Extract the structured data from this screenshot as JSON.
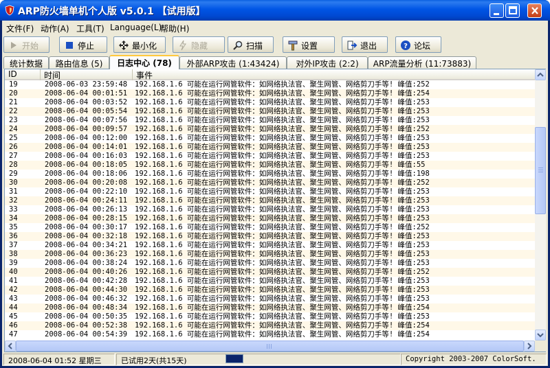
{
  "window": {
    "title": "ARP防火墙单机个人版 v5.0.1 【试用版】",
    "icon": "shield-icon"
  },
  "menu": {
    "items": [
      "文件(F)",
      "动作(A)",
      "工具(T)",
      "Language(L)",
      "帮助(H)"
    ]
  },
  "toolbar": {
    "buttons": [
      {
        "label": "开始",
        "icon": "play-icon",
        "enabled": false
      },
      {
        "label": "停止",
        "icon": "stop-icon",
        "enabled": true
      },
      {
        "label": "最小化",
        "icon": "minimize-arrows-icon",
        "enabled": true
      },
      {
        "label": "隐藏",
        "icon": "hide-icon",
        "enabled": false
      },
      {
        "label": "扫描",
        "icon": "magnifier-icon",
        "enabled": true
      },
      {
        "label": "设置",
        "icon": "settings-icon",
        "enabled": true
      },
      {
        "label": "退出",
        "icon": "exit-icon",
        "enabled": true
      },
      {
        "label": "论坛",
        "icon": "help-icon",
        "enabled": true
      }
    ]
  },
  "tabs": [
    {
      "label": "统计数据",
      "active": false
    },
    {
      "label": "路由信息 (5)",
      "active": false
    },
    {
      "label": "日志中心 (78)",
      "active": true
    },
    {
      "label": "外部ARP攻击 (1:43424)",
      "active": false
    },
    {
      "label": "对外IP攻击 (2:2)",
      "active": false
    },
    {
      "label": "ARP流量分析 (11:73883)",
      "active": false
    }
  ],
  "log": {
    "columns": [
      "ID",
      "时间",
      "事件"
    ],
    "rows": [
      [
        "19",
        "2008-06-03 23:59:48",
        "192.168.1.6 可能在运行网管软件：如网络执法官、聚生网管、网络剪刀手等! 峰值:252"
      ],
      [
        "20",
        "2008-06-04 00:01:51",
        "192.168.1.6 可能在运行网管软件：如网络执法官、聚生网管、网络剪刀手等! 峰值:254"
      ],
      [
        "21",
        "2008-06-04 00:03:52",
        "192.168.1.6 可能在运行网管软件：如网络执法官、聚生网管、网络剪刀手等! 峰值:253"
      ],
      [
        "22",
        "2008-06-04 00:05:54",
        "192.168.1.6 可能在运行网管软件：如网络执法官、聚生网管、网络剪刀手等! 峰值:253"
      ],
      [
        "23",
        "2008-06-04 00:07:56",
        "192.168.1.6 可能在运行网管软件：如网络执法官、聚生网管、网络剪刀手等! 峰值:253"
      ],
      [
        "24",
        "2008-06-04 00:09:57",
        "192.168.1.6 可能在运行网管软件：如网络执法官、聚生网管、网络剪刀手等! 峰值:252"
      ],
      [
        "25",
        "2008-06-04 00:12:00",
        "192.168.1.6 可能在运行网管软件：如网络执法官、聚生网管、网络剪刀手等! 峰值:253"
      ],
      [
        "26",
        "2008-06-04 00:14:01",
        "192.168.1.6 可能在运行网管软件：如网络执法官、聚生网管、网络剪刀手等! 峰值:253"
      ],
      [
        "27",
        "2008-06-04 00:16:03",
        "192.168.1.6 可能在运行网管软件：如网络执法官、聚生网管、网络剪刀手等! 峰值:253"
      ],
      [
        "28",
        "2008-06-04 00:18:05",
        "192.168.1.6 可能在运行网管软件：如网络执法官、聚生网管、网络剪刀手等! 峰值:55"
      ],
      [
        "29",
        "2008-06-04 00:18:06",
        "192.168.1.6 可能在运行网管软件：如网络执法官、聚生网管、网络剪刀手等! 峰值:198"
      ],
      [
        "30",
        "2008-06-04 00:20:08",
        "192.168.1.6 可能在运行网管软件：如网络执法官、聚生网管、网络剪刀手等! 峰值:252"
      ],
      [
        "31",
        "2008-06-04 00:22:10",
        "192.168.1.6 可能在运行网管软件：如网络执法官、聚生网管、网络剪刀手等! 峰值:253"
      ],
      [
        "32",
        "2008-06-04 00:24:11",
        "192.168.1.6 可能在运行网管软件：如网络执法官、聚生网管、网络剪刀手等! 峰值:253"
      ],
      [
        "33",
        "2008-06-04 00:26:13",
        "192.168.1.6 可能在运行网管软件：如网络执法官、聚生网管、网络剪刀手等! 峰值:253"
      ],
      [
        "34",
        "2008-06-04 00:28:15",
        "192.168.1.6 可能在运行网管软件：如网络执法官、聚生网管、网络剪刀手等! 峰值:253"
      ],
      [
        "35",
        "2008-06-04 00:30:17",
        "192.168.1.6 可能在运行网管软件：如网络执法官、聚生网管、网络剪刀手等! 峰值:252"
      ],
      [
        "36",
        "2008-06-04 00:32:18",
        "192.168.1.6 可能在运行网管软件：如网络执法官、聚生网管、网络剪刀手等! 峰值:253"
      ],
      [
        "37",
        "2008-06-04 00:34:21",
        "192.168.1.6 可能在运行网管软件：如网络执法官、聚生网管、网络剪刀手等! 峰值:253"
      ],
      [
        "38",
        "2008-06-04 00:36:23",
        "192.168.1.6 可能在运行网管软件：如网络执法官、聚生网管、网络剪刀手等! 峰值:253"
      ],
      [
        "39",
        "2008-06-04 00:38:24",
        "192.168.1.6 可能在运行网管软件：如网络执法官、聚生网管、网络剪刀手等! 峰值:253"
      ],
      [
        "40",
        "2008-06-04 00:40:26",
        "192.168.1.6 可能在运行网管软件：如网络执法官、聚生网管、网络剪刀手等! 峰值:252"
      ],
      [
        "41",
        "2008-06-04 00:42:28",
        "192.168.1.6 可能在运行网管软件：如网络执法官、聚生网管、网络剪刀手等! 峰值:253"
      ],
      [
        "42",
        "2008-06-04 00:44:30",
        "192.168.1.6 可能在运行网管软件：如网络执法官、聚生网管、网络剪刀手等! 峰值:253"
      ],
      [
        "43",
        "2008-06-04 00:46:32",
        "192.168.1.6 可能在运行网管软件：如网络执法官、聚生网管、网络剪刀手等! 峰值:253"
      ],
      [
        "44",
        "2008-06-04 00:48:34",
        "192.168.1.6 可能在运行网管软件：如网络执法官、聚生网管、网络剪刀手等! 峰值:254"
      ],
      [
        "45",
        "2008-06-04 00:50:35",
        "192.168.1.6 可能在运行网管软件：如网络执法官、聚生网管、网络剪刀手等! 峰值:253"
      ],
      [
        "46",
        "2008-06-04 00:52:38",
        "192.168.1.6 可能在运行网管软件：如网络执法官、聚生网管、网络剪刀手等! 峰值:254"
      ],
      [
        "47",
        "2008-06-04 00:54:39",
        "192.168.1.6 可能在运行网管软件：如网络执法官、聚生网管、网络剪刀手等! 峰值:254"
      ]
    ]
  },
  "status": {
    "datetime": "2008-06-04 01:52 星期三",
    "trial": "已试用2天(共15天)",
    "copyright": "Copyright 2003-2007 ColorSoft."
  }
}
